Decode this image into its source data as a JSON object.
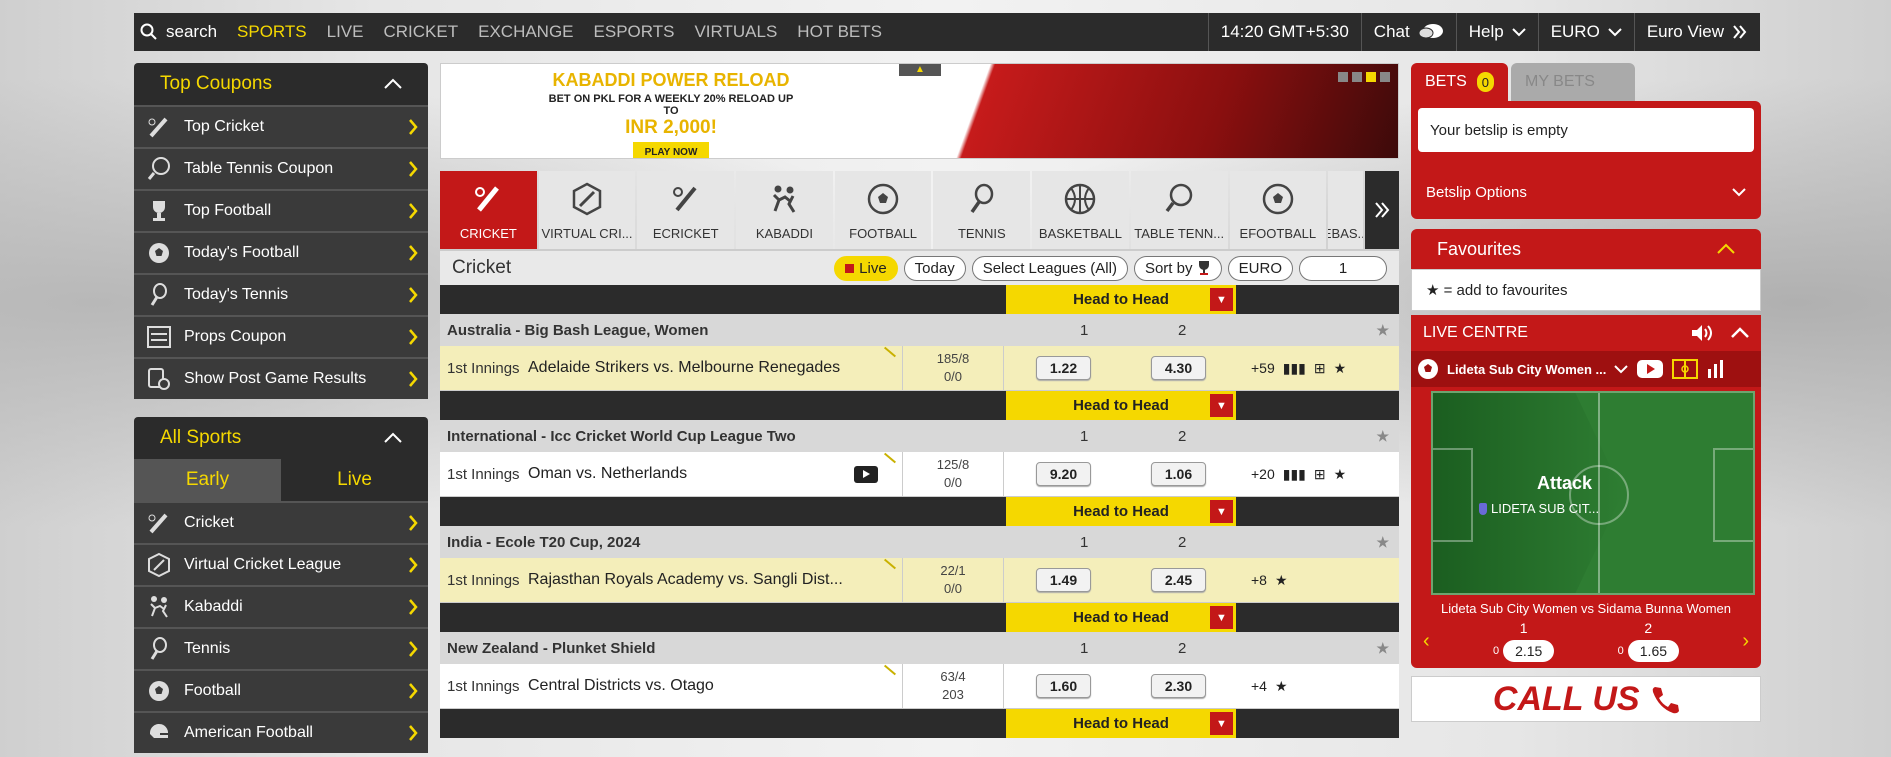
{
  "topnav": {
    "search_label": "search",
    "links": [
      {
        "label": "SPORTS",
        "active": true
      },
      {
        "label": "LIVE"
      },
      {
        "label": "CRICKET"
      },
      {
        "label": "EXCHANGE"
      },
      {
        "label": "ESPORTS"
      },
      {
        "label": "VIRTUALS"
      },
      {
        "label": "HOT BETS"
      }
    ],
    "time": "14:20 GMT+5:30",
    "chat": "Chat",
    "help": "Help",
    "currency": "EURO",
    "view": "Euro View"
  },
  "sidebar": {
    "top_coupons_title": "Top Coupons",
    "top_coupons": [
      {
        "label": "Top Cricket",
        "icon": "cricket-bat-icon"
      },
      {
        "label": "Table Tennis Coupon",
        "icon": "table-tennis-icon"
      },
      {
        "label": "Top Football",
        "icon": "trophy-icon"
      },
      {
        "label": "Today's Football",
        "icon": "football-icon"
      },
      {
        "label": "Today's Tennis",
        "icon": "tennis-icon"
      },
      {
        "label": "Props Coupon",
        "icon": "props-bets-icon"
      },
      {
        "label": "Show Post Game Results",
        "icon": "results-icon"
      }
    ],
    "all_sports_title": "All Sports",
    "tab_early": "Early",
    "tab_live": "Live",
    "sports": [
      {
        "label": "Cricket",
        "icon": "cricket-bat-icon"
      },
      {
        "label": "Virtual Cricket League",
        "icon": "virtual-cricket-icon"
      },
      {
        "label": "Kabaddi",
        "icon": "kabaddi-icon"
      },
      {
        "label": "Tennis",
        "icon": "tennis-icon"
      },
      {
        "label": "Football",
        "icon": "football-icon"
      },
      {
        "label": "American Football",
        "icon": "american-football-icon"
      }
    ]
  },
  "banner": {
    "title": "KABADDI POWER RELOAD",
    "subtitle": "BET ON PKL FOR A WEEKLY 20% RELOAD UP TO",
    "amount": "INR 2,000!",
    "cta": "PLAY NOW"
  },
  "sport_tabs": [
    {
      "label": "CRICKET",
      "active": true
    },
    {
      "label": "VIRTUAL CRI..."
    },
    {
      "label": "ECRICKET"
    },
    {
      "label": "KABADDI"
    },
    {
      "label": "FOOTBALL"
    },
    {
      "label": "TENNIS"
    },
    {
      "label": "BASKETBALL"
    },
    {
      "label": "TABLE TENN..."
    },
    {
      "label": "EFOOTBALL"
    },
    {
      "label": "EBAS..."
    }
  ],
  "filter": {
    "title": "Cricket",
    "live": "Live",
    "today": "Today",
    "leagues": "Select Leagues (All)",
    "sort": "Sort by",
    "currency": "EURO",
    "page": "1"
  },
  "h2h_label": "Head to Head",
  "col1": "1",
  "col2": "2",
  "leagues": [
    {
      "name": "Australia - Big Bash League, Women",
      "innings": "1st Innings",
      "match": "Adelaide Strikers vs. Melbourne Renegades",
      "score1": "185/8",
      "score2": "0/0",
      "odd1": "1.22",
      "odd2": "4.30",
      "more": "+59"
    },
    {
      "name": "International - Icc Cricket World Cup League Two",
      "innings": "1st Innings",
      "match": "Oman vs. Netherlands",
      "score1": "125/8",
      "score2": "0/0",
      "odd1": "9.20",
      "odd2": "1.06",
      "more": "+20"
    },
    {
      "name": "India - Ecole T20 Cup, 2024",
      "innings": "1st Innings",
      "match": "Rajasthan Royals Academy vs. Sangli Dist...",
      "score1": "22/1",
      "score2": "0/0",
      "odd1": "1.49",
      "odd2": "2.45",
      "more": "+8"
    },
    {
      "name": "New Zealand - Plunket Shield",
      "innings": "1st Innings",
      "match": "Central Districts vs. Otago",
      "score1": "63/4",
      "score2": "203",
      "odd1": "1.60",
      "odd2": "2.30",
      "more": "+4"
    }
  ],
  "betslip": {
    "bets_label": "BETS",
    "bets_count": "0",
    "mybets_label": "MY BETS",
    "empty": "Your betslip is empty",
    "options": "Betslip Options"
  },
  "favourites": {
    "title": "Favourites",
    "hint": "= add to favourites"
  },
  "live_centre": {
    "title": "LIVE CENTRE",
    "selected": "Lideta Sub City Women ...",
    "state": "Attack",
    "team": "LIDETA SUB CIT...",
    "match": "Lideta Sub City Women vs Sidama Bunna Women",
    "col1": "1",
    "col2": "2",
    "zero1": "0",
    "odd1": "2.15",
    "zero2": "0",
    "odd2": "1.65"
  },
  "call_us": "CALL US",
  "colors": {
    "accent": "#f5d800",
    "brand": "#c31818",
    "dark": "#2b2b2b"
  }
}
